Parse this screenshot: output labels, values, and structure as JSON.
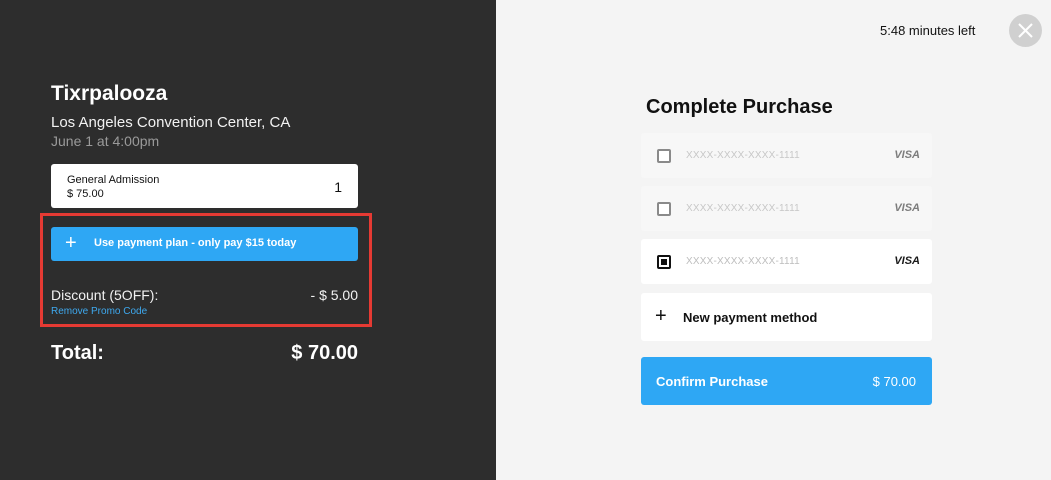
{
  "event": {
    "title": "Tixrpalooza",
    "venue": "Los Angeles Convention Center, CA",
    "date": "June 1 at 4:00pm"
  },
  "ticket": {
    "name": "General Admission",
    "price": "$ 75.00",
    "quantity": "1"
  },
  "payment_plan": {
    "icon": "plus-icon",
    "label": "Use payment plan - only pay $15 today"
  },
  "discount": {
    "label": "Discount (5OFF):",
    "amount": "- $ 5.00",
    "remove_label": "Remove Promo Code"
  },
  "total": {
    "label": "Total:",
    "amount": "$ 70.00"
  },
  "timer": "5:48 minutes left",
  "checkout": {
    "title": "Complete Purchase",
    "cards": [
      {
        "number": "XXXX-XXXX-XXXX-1111",
        "brand": "VISA",
        "selected": false
      },
      {
        "number": "XXXX-XXXX-XXXX-1111",
        "brand": "VISA",
        "selected": false
      },
      {
        "number": "XXXX-XXXX-XXXX-1111",
        "brand": "VISA",
        "selected": true
      }
    ],
    "new_method_label": "New payment method",
    "confirm_label": "Confirm Purchase",
    "confirm_amount": "$ 70.00"
  },
  "colors": {
    "left_bg": "#2d2d2d",
    "right_bg": "#f4f4f4",
    "accent": "#2ea7f4",
    "highlight": "#e53a33",
    "link": "#3ea9ef"
  }
}
